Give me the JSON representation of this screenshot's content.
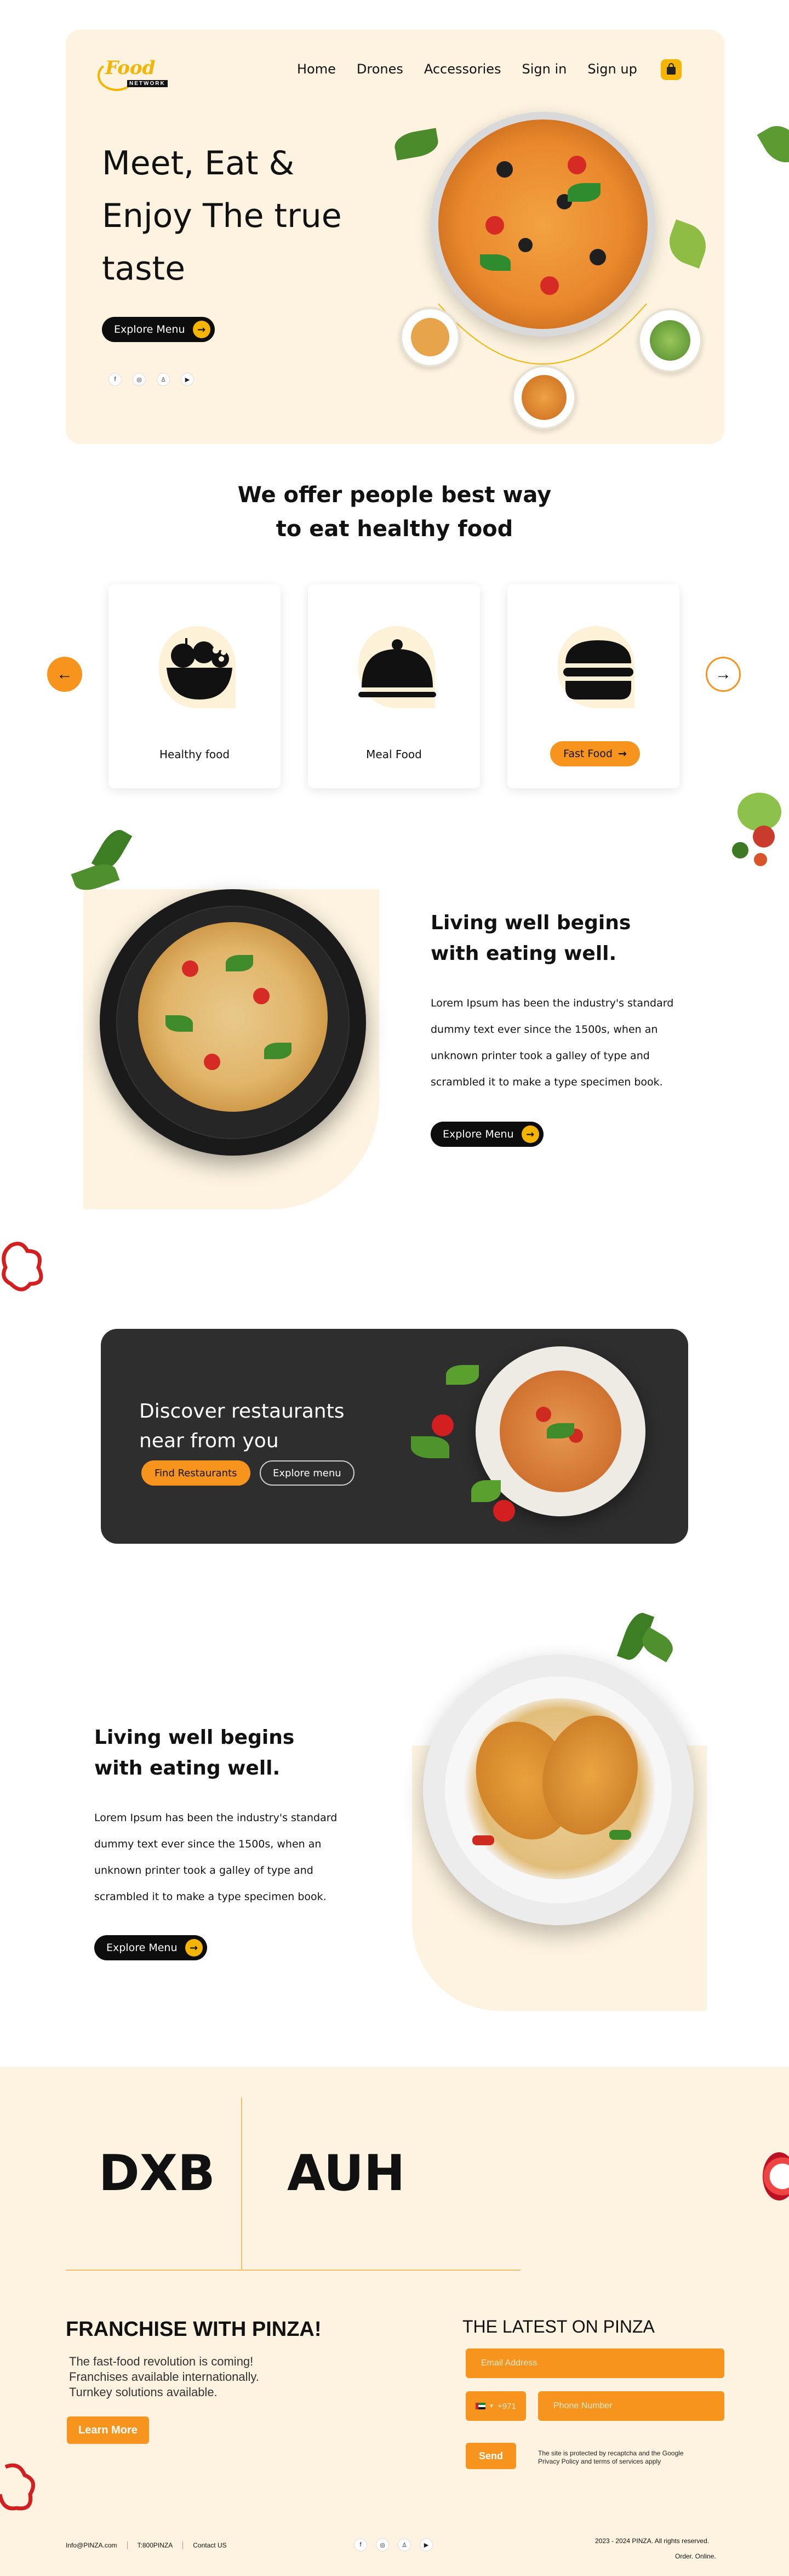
{
  "brand": {
    "logo_top": "Food",
    "logo_bottom": "NETWORK"
  },
  "nav": {
    "items": [
      "Home",
      "Drones",
      "Accessories",
      "Sign in",
      "Sign up"
    ]
  },
  "hero": {
    "title_lines": [
      "Meet, Eat &",
      "Enjoy The true",
      "taste"
    ],
    "cta_label": "Explore Menu"
  },
  "offer": {
    "heading_lines": [
      "We offer people best way",
      "to eat healthy food"
    ],
    "cards": [
      {
        "label": "Healthy food",
        "icon": "fruit-basket-icon"
      },
      {
        "label": "Meal Food",
        "icon": "cloche-icon"
      },
      {
        "label": "Fast Food",
        "icon": "burger-icon"
      }
    ]
  },
  "feature1": {
    "heading_lines": [
      "Living well begins",
      "with eating well."
    ],
    "body_lines": [
      "Lorem Ipsum has been the industry's standard",
      "dummy text ever since the 1500s, when an",
      "unknown printer took a galley of type and",
      "scrambled it to make a type specimen book."
    ],
    "cta_label": "Explore Menu"
  },
  "discover": {
    "heading_lines": [
      "Discover restaurants",
      "near from you"
    ],
    "primary_label": "Find Restaurants",
    "secondary_label": "Explore menu"
  },
  "feature2": {
    "heading_lines": [
      "Living well begins",
      "with eating well."
    ],
    "body_lines": [
      "Lorem Ipsum has been the industry's standard",
      "dummy text ever since the 1500s, when an",
      "unknown printer took a galley of type and",
      "scrambled it to make a type specimen book."
    ],
    "cta_label": "Explore Menu"
  },
  "cities": [
    "DXB",
    "AUH"
  ],
  "franchise": {
    "heading": "FRANCHISE WITH PINZA!",
    "lines": [
      "The fast-food revolution is coming!",
      "Franchises available internationally.",
      "Turnkey solutions available."
    ],
    "cta_label": "Learn More"
  },
  "newsletter": {
    "heading": "THE LATEST ON PINZA",
    "email_placeholder": "Email Address",
    "country_code": "+971",
    "phone_placeholder": "Phone Number",
    "send_label": "Send",
    "recaptcha_lines": [
      "The site is protected by recaptcha and the Google",
      "Privacy Policy and terms of services apply"
    ]
  },
  "footer": {
    "links": [
      "Info@PINZA.com",
      "T:800PINZA",
      "Contact US"
    ],
    "copyright": "2023 - 2024 PINZA. All rights reserved.",
    "order_text": "Order. Online."
  },
  "colors": {
    "accent": "#f7941d",
    "cream": "#fdf3e0",
    "dark_panel": "#2e2e2e",
    "yellow": "#f4b400"
  }
}
